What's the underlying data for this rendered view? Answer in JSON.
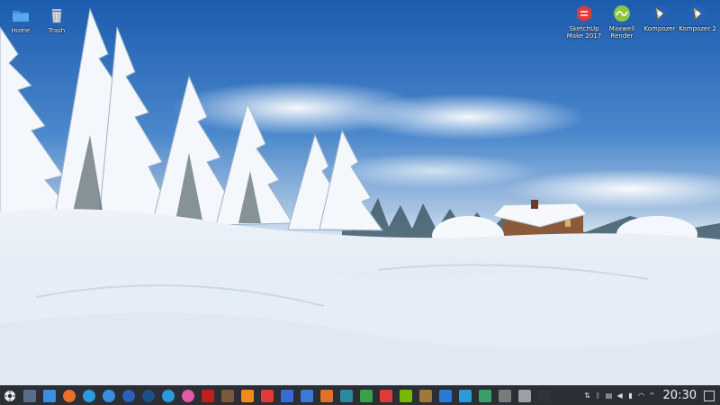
{
  "desktop": {
    "icons_left": [
      {
        "label": "Home",
        "icon": "folder-home-icon",
        "color": "#3a8fe0"
      },
      {
        "label": "Trash",
        "icon": "trash-icon",
        "color": "#d0d0d0"
      }
    ],
    "icons_right": [
      {
        "label": "SketchUp Make 2017",
        "icon": "sketchup-icon",
        "color": "#e03a3a"
      },
      {
        "label": "Maxwell Render",
        "icon": "maxwell-icon",
        "color": "#8dc63f"
      },
      {
        "label": "Kompozer",
        "icon": "kompozer-icon",
        "color": "#2b5fb8"
      },
      {
        "label": "Kompozer 2",
        "icon": "kompozer-icon",
        "color": "#2b5fb8"
      }
    ]
  },
  "taskbar": {
    "start_icon": "application-menu-icon",
    "launchers": [
      {
        "name": "virtual-desktops",
        "color": "#5a6d8a"
      },
      {
        "name": "file-manager",
        "color": "#3a8fe0"
      },
      {
        "name": "firefox",
        "color": "#e8702a"
      },
      {
        "name": "edge",
        "color": "#2a9ad8"
      },
      {
        "name": "browser",
        "color": "#3a8fe0"
      },
      {
        "name": "kompozer",
        "color": "#2b5fb8"
      },
      {
        "name": "steam",
        "color": "#1b4f8a"
      },
      {
        "name": "vpn",
        "color": "#2a9ad8"
      },
      {
        "name": "screen-recorder",
        "color": "#e05aa8"
      },
      {
        "name": "bug-app",
        "color": "#c02020"
      },
      {
        "name": "tool",
        "color": "#7a5a3a"
      },
      {
        "name": "vlc",
        "color": "#f28a1a"
      },
      {
        "name": "sketchup",
        "color": "#e03a3a"
      },
      {
        "name": "visual-app",
        "color": "#3a6ad8"
      },
      {
        "name": "document",
        "color": "#3a7ad8"
      },
      {
        "name": "presentation",
        "color": "#e0702a"
      },
      {
        "name": "slack",
        "color": "#2a8aa0"
      },
      {
        "name": "spreadsheet",
        "color": "#3aa04a"
      },
      {
        "name": "pdf",
        "color": "#e03a3a"
      },
      {
        "name": "nvidia",
        "color": "#76b900"
      },
      {
        "name": "box-app",
        "color": "#a0783a"
      },
      {
        "name": "writer",
        "color": "#2a7ad8"
      },
      {
        "name": "store",
        "color": "#2a9ad8"
      },
      {
        "name": "image-viewer",
        "color": "#3aa06a"
      },
      {
        "name": "calculator",
        "color": "#7a7a7a"
      },
      {
        "name": "system-monitor",
        "color": "#9aa0a8"
      },
      {
        "name": "terminal",
        "color": "#30343a"
      }
    ],
    "tray_icons": [
      "network-icon",
      "bluetooth-icon",
      "clipboard-icon",
      "volume-icon",
      "battery-icon",
      "wifi-icon",
      "expand-arrow-icon"
    ],
    "clock": "20:30",
    "show_desktop_icon": "show-desktop-icon"
  }
}
